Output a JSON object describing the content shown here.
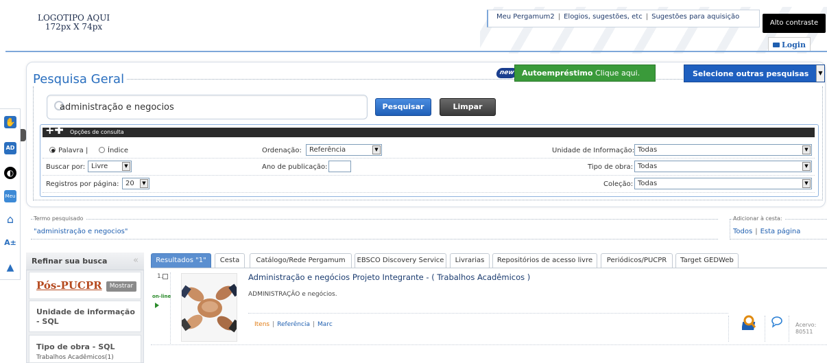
{
  "logo": {
    "line1": "LOGOTIPO AQUI",
    "line2": "172px X 74px"
  },
  "toplinks": {
    "meu_pergamum": "Meu Pergamum2",
    "elogios": "Elogios, sugestões, etc",
    "sugestoes": "Sugestões para aquisição",
    "separator": "|"
  },
  "alto_contraste": "Alto contraste",
  "login": "Login",
  "search": {
    "title": "Pesquisa Geral",
    "new_badge": "new",
    "autoemprestimo_bold": "Autoempréstimo",
    "autoemprestimo_rest": "Clique aqui.",
    "outras": "Selecione outras pesquisas",
    "query": "administração e negocios",
    "pesquisar": "Pesquisar",
    "limpar": "Limpar"
  },
  "options": {
    "header": "Opções de consulta",
    "palavra": "Palavra |",
    "indice": "Índice",
    "buscar_por_label": "Buscar por:",
    "buscar_por_value": "Livre",
    "registros_label": "Registros por página:",
    "registros_value": "20",
    "ordenacao_label": "Ordenação:",
    "ordenacao_value": "Referência",
    "ano_label": "Ano de publicação:",
    "unidade_label": "Unidade de Informação:",
    "unidade_value": "Todas",
    "tipo_label": "Tipo de obra:",
    "tipo_value": "Todas",
    "colecao_label": "Coleção:",
    "colecao_value": "Todas"
  },
  "termo": {
    "caption": "Termo pesquisado",
    "value": "\"administração e negocios\""
  },
  "cesta": {
    "caption": "Adicionar à cesta:",
    "todos": "Todos",
    "esta_pagina": "Esta página",
    "separator": "|"
  },
  "refinar": {
    "title": "Refinar sua busca",
    "collapse": "«",
    "pos": "Pós-PUCPR",
    "mostrar": "Mostrar",
    "unidade_title": "Unidade de informação - SQL",
    "tipo_title": "Tipo de obra - SQL",
    "tipo_item": "Trabalhos Acadêmicos(1)"
  },
  "tabs": [
    "Resultados \"1\"",
    "Cesta",
    "Catálogo/Rede Pergamum",
    "EBSCO Discovery Service",
    "Livrarias",
    "Repositórios de acesso livre",
    "Periódicos/PUCPR",
    "Target GEDWeb"
  ],
  "result": {
    "number": "1.",
    "online": "on-line",
    "title": "Administração e negócios Projeto Integrante - ( Trabalhos Acadêmicos )",
    "description": "ADMINISTRAÇÃO e negócios.",
    "link_itens": "Itens",
    "link_referencia": "Referência",
    "link_marc": "Marc",
    "separator": "|",
    "acervo_label": "Acervo:",
    "acervo_value": "80511"
  },
  "colors": {
    "accent_blue": "#2a6fbf",
    "green_button": "#3a9a3a",
    "tab_active": "#5b8fd0",
    "pos_title": "#b54a1f"
  }
}
